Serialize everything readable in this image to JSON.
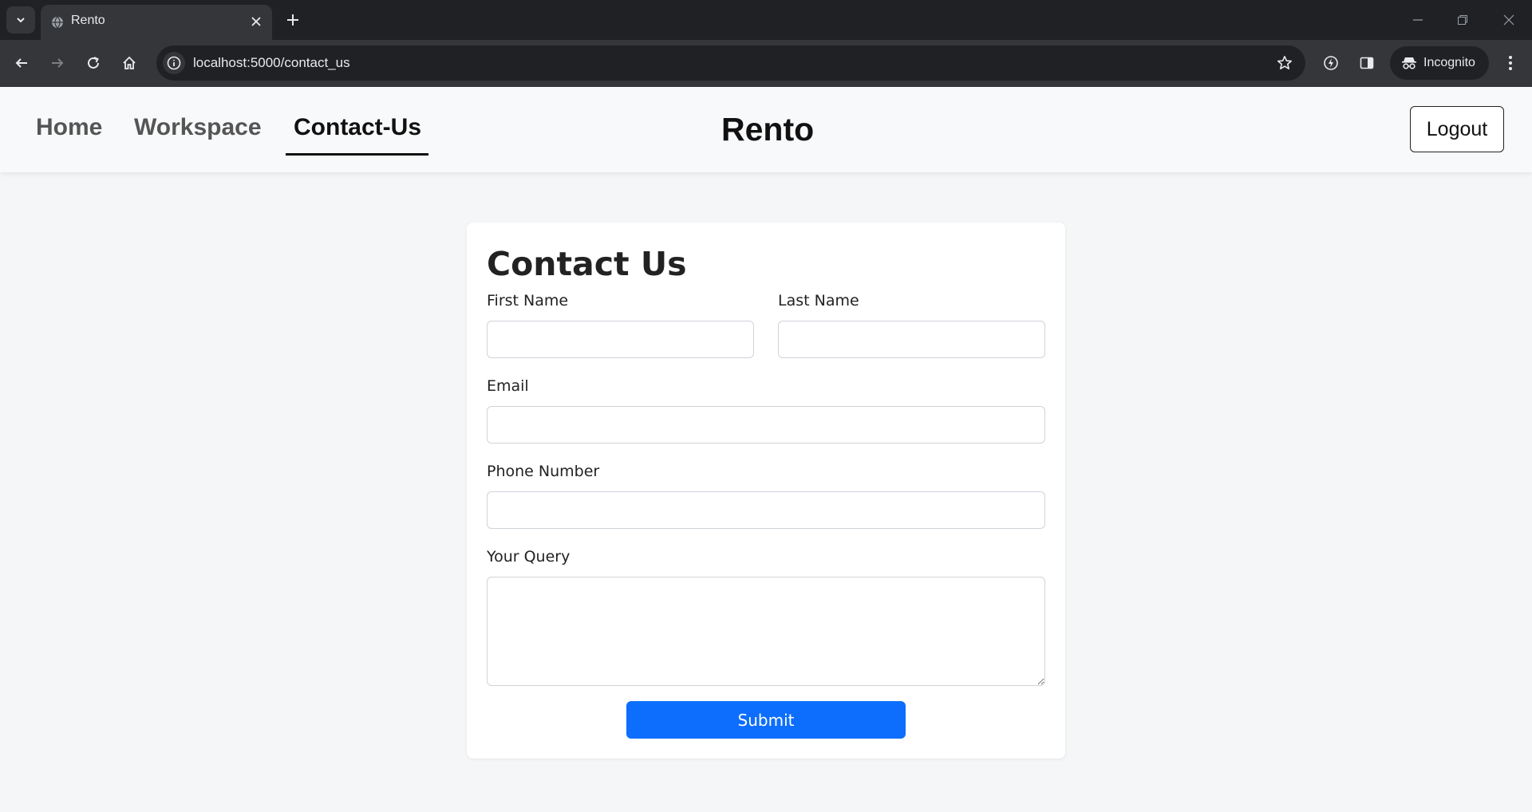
{
  "browser": {
    "tab_title": "Rento",
    "url": "localhost:5000/contact_us",
    "incognito_label": "Incognito"
  },
  "nav": {
    "links": [
      "Home",
      "Workspace",
      "Contact-Us"
    ],
    "active": "Contact-Us",
    "brand": "Rento",
    "logout_label": "Logout"
  },
  "form": {
    "title": "Contact Us",
    "first_name_label": "First Name",
    "first_name_value": "",
    "last_name_label": "Last Name",
    "last_name_value": "",
    "email_label": "Email",
    "email_value": "",
    "phone_label": "Phone Number",
    "phone_value": "",
    "query_label": "Your Query",
    "query_value": "",
    "submit_label": "Submit"
  },
  "colors": {
    "primary": "#0d6efd",
    "chrome_dark": "#202124",
    "chrome_toolbar": "#35363a",
    "page_bg": "#f5f6f8"
  }
}
